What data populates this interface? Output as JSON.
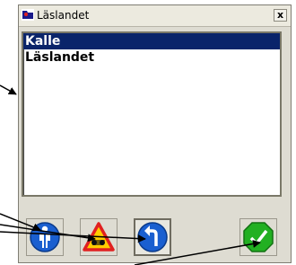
{
  "window": {
    "title": "Läslandet",
    "close_label": "x"
  },
  "list": {
    "items": [
      {
        "label": "Kalle",
        "selected": true
      },
      {
        "label": "Läslandet",
        "selected": false
      }
    ]
  },
  "toolbar": {
    "buttons": [
      {
        "name": "person-info-button",
        "icon": "person-info-icon"
      },
      {
        "name": "warning-button",
        "icon": "warning-triangle-icon"
      },
      {
        "name": "back-button",
        "icon": "turn-back-arrow-icon"
      },
      {
        "name": "done-button",
        "icon": "checkmark-octagon-icon"
      }
    ]
  },
  "colors": {
    "selection": "#0a246a",
    "info_blue": "#1a5fd0",
    "warning_red": "#e02020",
    "done_green": "#22b022"
  }
}
